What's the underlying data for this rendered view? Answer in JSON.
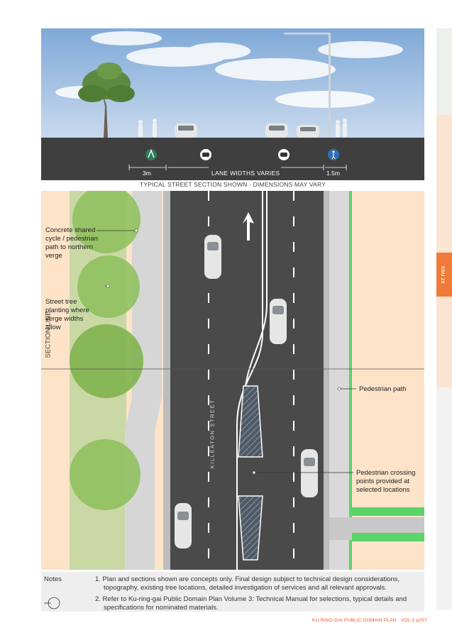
{
  "tab": {
    "suburb": "ST IVES"
  },
  "section": {
    "dim_left": "3m",
    "dim_center": "LANE WIDTHS VARIES",
    "dim_right": "1.5m",
    "caption": "TYPICAL STREET SECTION SHOWN - DIMENSIONS MAY VARY"
  },
  "plan": {
    "section_line_label": "SECTION LINE",
    "street_name": "KILLEATON STREET",
    "labels": {
      "shared_path": [
        "Concrete shared",
        "cycle / pedestrian",
        "path to northern",
        "verge"
      ],
      "street_tree": [
        "Street tree",
        "planting where",
        "verge widths",
        "allow"
      ],
      "pedestrian_path": [
        "Pedestrian path"
      ],
      "crossing": [
        "Pedestrian crossing",
        "points provided at",
        "selected locations"
      ]
    }
  },
  "notes": {
    "title": "Notes",
    "items": [
      [
        "1.  Plan and sections shown are concepts only. Final design subject to technical design considerations,",
        "topography, existing tree locations, detailed investigation of services and all relevant approvals."
      ],
      [
        "2.  Refer to Ku-ring-gai Public Domain Plan Volume 3: Technical Manual for selections, typical details and",
        "specifications for nominated materials."
      ]
    ]
  },
  "footer": {
    "doc": "KU-RING-GAI PUBLIC DOMAIN PLAN",
    "page": "VOL.2 p257"
  },
  "colors": {
    "accent": "#f07a38",
    "verge": "#fde3c8",
    "road": "#4a4a4a",
    "grass": "#4cc47a"
  }
}
